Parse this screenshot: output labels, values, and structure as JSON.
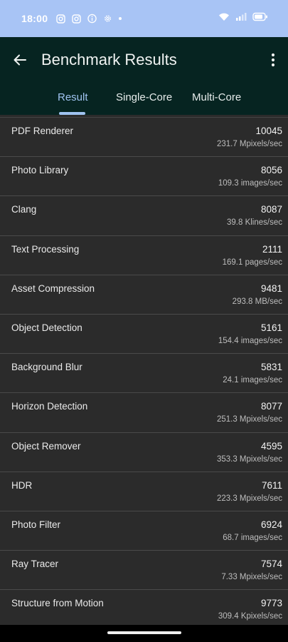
{
  "status_bar": {
    "time": "18:00",
    "left_icons": [
      "instagram-icon",
      "instagram-icon",
      "info-icon",
      "settings-icon",
      "dot-icon"
    ],
    "right_icons": [
      "wifi-icon",
      "signal-icon",
      "battery-icon"
    ]
  },
  "app_bar": {
    "title": "Benchmark Results",
    "back_icon": "arrow-left-icon",
    "menu_icon": "more-vert-icon"
  },
  "tabs": [
    {
      "label": "Result",
      "active": true
    },
    {
      "label": "Single-Core",
      "active": false
    },
    {
      "label": "Multi-Core",
      "active": false
    }
  ],
  "results": [
    {
      "name": "PDF Renderer",
      "score": "10045",
      "rate": "231.7 Mpixels/sec"
    },
    {
      "name": "Photo Library",
      "score": "8056",
      "rate": "109.3 images/sec"
    },
    {
      "name": "Clang",
      "score": "8087",
      "rate": "39.8 Klines/sec"
    },
    {
      "name": "Text Processing",
      "score": "2111",
      "rate": "169.1 pages/sec"
    },
    {
      "name": "Asset Compression",
      "score": "9481",
      "rate": "293.8 MB/sec"
    },
    {
      "name": "Object Detection",
      "score": "5161",
      "rate": "154.4 images/sec"
    },
    {
      "name": "Background Blur",
      "score": "5831",
      "rate": "24.1 images/sec"
    },
    {
      "name": "Horizon Detection",
      "score": "8077",
      "rate": "251.3 Mpixels/sec"
    },
    {
      "name": "Object Remover",
      "score": "4595",
      "rate": "353.3 Mpixels/sec"
    },
    {
      "name": "HDR",
      "score": "7611",
      "rate": "223.3 Mpixels/sec"
    },
    {
      "name": "Photo Filter",
      "score": "6924",
      "rate": "68.7 images/sec"
    },
    {
      "name": "Ray Tracer",
      "score": "7574",
      "rate": "7.33 Mpixels/sec"
    },
    {
      "name": "Structure from Motion",
      "score": "9773",
      "rate": "309.4 Kpixels/sec"
    }
  ],
  "colors": {
    "status_bar_bg": "#a8c4f5",
    "app_bar_bg": "#062421",
    "accent": "#9fc3f0",
    "list_bg": "#2b2b2b"
  }
}
